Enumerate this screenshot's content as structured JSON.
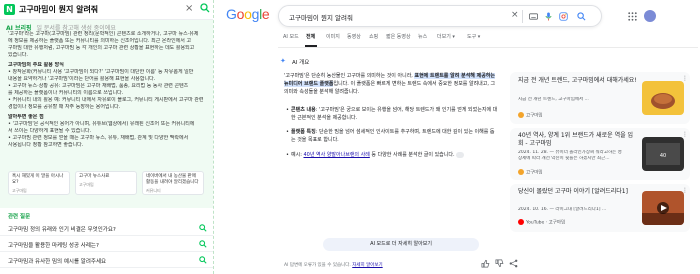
{
  "naver": {
    "logo": "N",
    "query_title": "고구마밈이 뭔지 알려줘",
    "close_glyph": "×",
    "briefing_label": "AI 브리핑",
    "briefing_note": "일 문서를 참고해 생성 중이에요",
    "lines": [
      "'고구마'라는 고구마(고구마밈) 관련 정리(문학적인) 콘텐츠로 소개하거나, 고구마 뉴스·유제",
      "에 정보를 제공하는 플랫폼 또는 커뮤니티를 의미하는 신조어입니다. 최근 온라인에서 고",
      "구마밈 대한 유행처럼, 고구마밈 등 각 개인의 고구마 관련 상황을 표현하는 데도 활용되고",
      "있습니다."
    ],
    "sections": [
      {
        "title": "고구마밈의 주요 활용 방식",
        "items": [
          "• 창작문화(커뮤니티 사용 '고구마밈이 되다?' '고구마밈이 대단한 이름' 등 자유롭게 일반",
          "  내용을 요약하거나 '고구마밈'이라는 단어를 활용해 표현을 사용합니다.",
          "• 고구마 뉴스·상황 공유: 고구마밈은 고구마 재배법, 품종, 요리법 등 농사 관련 콘텐츠",
          "  를 제공하는 플랫폼이나 커뮤니티의 이름으로 쓰입니다.",
          "• 커뮤니티 내의 활용 예: 커뮤니티 내에서 자유로이 블로그, 커뮤니티 게시판에서 고구마 관련",
          "  경험이나 정보를 공유할 때 자주 등장하는 용어입니다."
        ]
      },
      {
        "title": "알아두면 좋은 점",
        "items": [
          "• '고구마밈'은 공식적인 용어가 아니며, 유튜브(웹상에서) 유래된 신조어 또는 커뮤니티에",
          "  서 쓰이는 다양하게 표현될 수 있습니다.",
          "• 고구마밈 관련 정보를 얻을 때는 고구마 뉴스, 유튜, 재배법, 관계 및 다양한 맥락에서",
          "  사용됩니다 정황 참고하면 좋습니다."
        ]
      }
    ],
    "cards": [
      {
        "text": "혹시 재밌게 이 말을 아시나요?",
        "src": "고구마밈"
      },
      {
        "text": "고구마 뉴스사료",
        "src": "고구마밈"
      },
      {
        "text": "네이버에서 내 농산물 판매 활동을 내려야 알리겠습니다",
        "src": "커뮤니티"
      }
    ],
    "related_label": "관련 질문",
    "related": [
      "고구마밈 정의 유래와 인기 비결은 무엇인가요?",
      "고구마밈을 활용한 마케팅 성공 사례는?",
      "고구마밈과 유사한 밈의 예시를 알려주세요"
    ]
  },
  "google": {
    "logo_letters": [
      {
        "ch": "G",
        "color": "#4285F4"
      },
      {
        "ch": "o",
        "color": "#EA4335"
      },
      {
        "ch": "o",
        "color": "#FBBC05"
      },
      {
        "ch": "g",
        "color": "#4285F4"
      },
      {
        "ch": "l",
        "color": "#34A853"
      },
      {
        "ch": "e",
        "color": "#EA4335"
      }
    ],
    "query": "고구마밈이 뭔지 알려줘",
    "tabs": [
      "AI 모드",
      "전체",
      "이미지",
      "동영상",
      "쇼핑",
      "짧은 동영상",
      "뉴스",
      "더보기 ▾",
      "도구 ▾"
    ],
    "active_tab": "전체",
    "ai_overview_label": "AI 개요",
    "para1_plain_a": "'고구마밈'은 단순히 농산물인 고구마를 의미하는 것이 아니라, ",
    "para1_hl": "표현에 트렌트를 알려 분석해 제공하는 뉴미디어 브랜드 플랫폼",
    "para1_plain_b": "입니다. 이 플랫폼은 빠르게 변하는 트렌드 속에서 중요한 정보를 알려내고, 그 의미와 속성들을 분석해 알려줍니다.",
    "bullets": [
      {
        "bold": "콘텐츠 내용",
        "text": ": '고구마밈'은 궁으로 보이는 유행을 넘어, 해당 트렌드가 왜 인기를 얻게 되었는지에 대한 근본적인 분석을 제공합니다."
      },
      {
        "bold": "플랫폼 특징",
        "text": ": 단순한 밈을 넘어 섬세적인 인사이트를 추구하며, 트렌드에 대한 깊이 있는 이해를 돕는 것을 목표로 합니다."
      },
      {
        "bold": "",
        "text": "예시: ",
        "link": "40년 역사 양말아나브랜의 사례",
        "tail": " 등 다양한 사례를 분석한 글이 있습니다."
      }
    ],
    "more_ai_button": "AI 모드로 더 자세히 알아보기",
    "footnote": "AI 답변에 오류가 있을 수 있습니다. ",
    "footnote_link": "자세히 알아보기",
    "side_cards": [
      {
        "title": "지금 전 개년 트렌드, 고구마밈에서 대해가세요!",
        "desc": "지금 전 개년 트렌드, 고구마밈에서 ...",
        "src": "고구마밈",
        "img_color": "#f3c23b"
      },
      {
        "title": "40년 역사, 양계 1위 브랜드가 새로운 역을 입 회 - 고구마밈",
        "desc": "2024. 11. 28. — 뷰이너 올라인가상씨 뭐라고하는 성",
        "desc2": "장세에 따라 개선 약진이 뒷들은 하겠지만 최근...",
        "src": "고구마밈",
        "img_color": "#3a3a3a"
      },
      {
        "title": "당신이 몰랐던 고구마 이야기 [알려드리다1]",
        "desc": "2024. 10. 16. — 라이그대 [알려드리다1] ...",
        "src": "YouTube · 고구마밈",
        "img_color": "#b0542c"
      }
    ]
  }
}
